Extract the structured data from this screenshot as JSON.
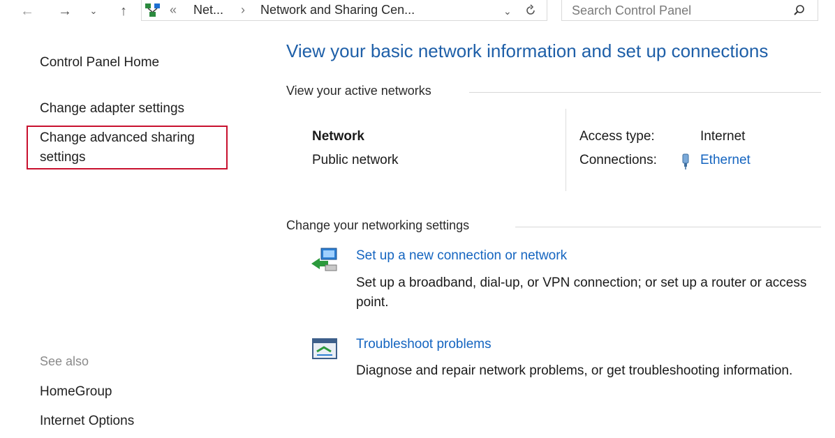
{
  "toolbar": {
    "back_icon": "back-arrow-icon",
    "forward_icon": "forward-arrow-icon",
    "recent_icon": "chevron-down-icon",
    "up_icon": "up-arrow-icon"
  },
  "address": {
    "overflow": "«",
    "crumb1": "Net...",
    "separator": "›",
    "crumb2": "Network and Sharing Cen...",
    "dropdown_icon": "chevron-down-icon",
    "refresh_icon": "refresh-icon"
  },
  "search": {
    "placeholder": "Search Control Panel",
    "icon": "search-icon"
  },
  "sidebar": {
    "home": "Control Panel Home",
    "items": [
      "Change adapter settings",
      "Change advanced sharing settings"
    ],
    "see_also_label": "See also",
    "see_also": [
      "HomeGroup",
      "Internet Options"
    ]
  },
  "highlight_color": "#c8102e",
  "main": {
    "title": "View your basic network information and set up connections",
    "active_networks_heading": "View your active networks",
    "network": {
      "name": "Network",
      "type": "Public network",
      "access_type_label": "Access type:",
      "access_type_value": "Internet",
      "connections_label": "Connections:",
      "connections_value": "Ethernet"
    },
    "settings_heading": "Change your networking settings",
    "tasks": [
      {
        "icon": "new-connection-icon",
        "link": "Set up a new connection or network",
        "description": "Set up a broadband, dial-up, or VPN connection; or set up a router or access point."
      },
      {
        "icon": "troubleshoot-icon",
        "link": "Troubleshoot problems",
        "description": "Diagnose and repair network problems, or get troubleshooting information."
      }
    ]
  }
}
